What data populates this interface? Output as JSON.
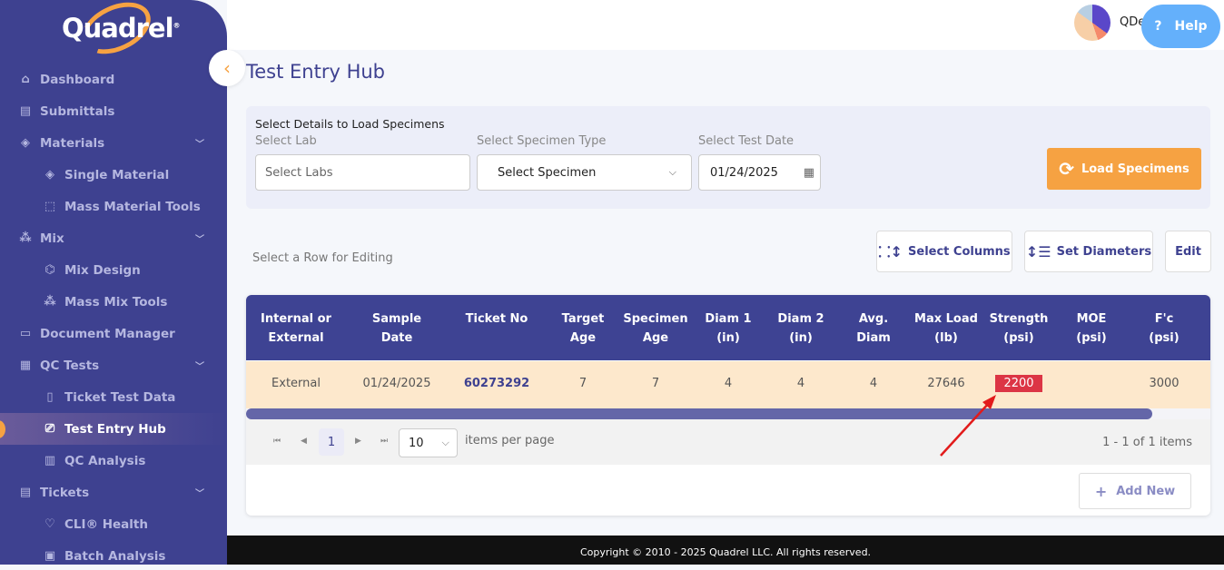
{
  "brand": {
    "logo": "Quadrel"
  },
  "sidebar": {
    "items": [
      {
        "label": "Dashboard",
        "icon": "home-icon",
        "ic": "⌂",
        "sub": false
      },
      {
        "label": "Submittals",
        "icon": "document-icon",
        "ic": "▤",
        "sub": false
      },
      {
        "label": "Materials",
        "icon": "layers-icon",
        "ic": "◈",
        "sub": false,
        "chev": true
      },
      {
        "label": "Single Material",
        "icon": "layers-icon",
        "ic": "◈",
        "sub": true
      },
      {
        "label": "Mass Material Tools",
        "icon": "tools-icon",
        "ic": "⬚",
        "sub": true
      },
      {
        "label": "Mix",
        "icon": "nodes-icon",
        "ic": "⁂",
        "sub": false,
        "chev": true
      },
      {
        "label": "Mix Design",
        "icon": "mix-design-icon",
        "ic": "⌬",
        "sub": true
      },
      {
        "label": "Mass Mix Tools",
        "icon": "nodes-icon",
        "ic": "⁂",
        "sub": true
      },
      {
        "label": "Document Manager",
        "icon": "folder-icon",
        "ic": "▭",
        "sub": false
      },
      {
        "label": "QC Tests",
        "icon": "calculator-icon",
        "ic": "▦",
        "sub": false,
        "chev": true
      },
      {
        "label": "Ticket Test Data",
        "icon": "clipboard-icon",
        "ic": "▯",
        "sub": true
      },
      {
        "label": "Test Entry Hub",
        "icon": "laptop-icon",
        "ic": "⎚",
        "sub": true,
        "active": true
      },
      {
        "label": "QC Analysis",
        "icon": "bar-chart-icon",
        "ic": "▥",
        "sub": true
      },
      {
        "label": "Tickets",
        "icon": "ticket-icon",
        "ic": "▤",
        "sub": false,
        "chev": true
      },
      {
        "label": "CLI® Health",
        "icon": "health-icon",
        "ic": "♡",
        "sub": true
      },
      {
        "label": "Batch Analysis",
        "icon": "batch-icon",
        "ic": "▣",
        "sub": true
      }
    ]
  },
  "header": {
    "user": "QDe",
    "help": "Help"
  },
  "page": {
    "title": "Test Entry Hub"
  },
  "filter": {
    "title": "Select Details to Load Specimens",
    "lab_label": "Select Lab",
    "lab_placeholder": "Select Labs",
    "type_label": "Select Specimen Type",
    "type_value": "Select Specimen",
    "date_label": "Select Test Date",
    "date_value": "01/24/2025",
    "load": "Load Specimens"
  },
  "toolbar": {
    "hint": "Select a Row for Editing",
    "select_columns": "Select Columns",
    "set_diameters": "Set Diameters",
    "edit": "Edit"
  },
  "table": {
    "columns": [
      "Internal or\nExternal",
      "Sample\nDate",
      "Ticket No",
      "Target\nAge",
      "Specimen\nAge",
      "Diam 1\n(in)",
      "Diam 2\n(in)",
      "Avg.\nDiam",
      "Max Load\n(lb)",
      "Strength\n(psi)",
      "MOE\n(psi)",
      "F'c\n(psi)"
    ],
    "rows": [
      [
        "External",
        "01/24/2025",
        "60273292",
        "7",
        "7",
        "4",
        "4",
        "4",
        "27646",
        "2200",
        "",
        "3000"
      ]
    ]
  },
  "pager": {
    "page": "1",
    "size": "10",
    "per_page": "items per page",
    "summary": "1 - 1 of 1 items"
  },
  "add_new": "Add New",
  "footer": "Copyright © 2010 - 2025 Quadrel LLC. All rights reserved.",
  "colors": {
    "sidebar": "#3e4190",
    "accent": "#f6a242",
    "alert": "#dc3545",
    "row": "#fde8cc"
  }
}
